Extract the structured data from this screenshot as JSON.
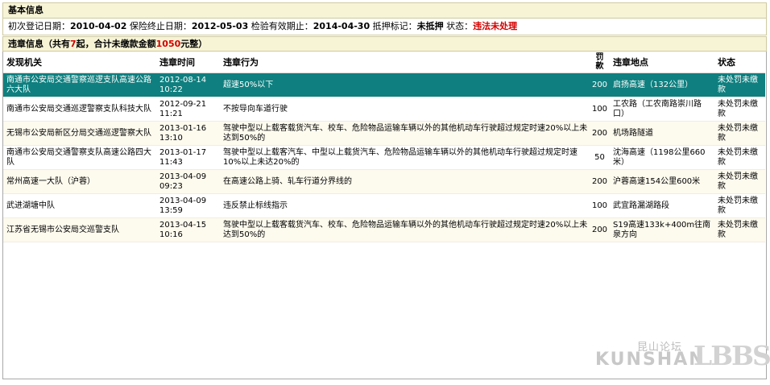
{
  "basic": {
    "title": "基本信息",
    "reg_label": "初次登记日期：",
    "reg_value": "2010-04-02",
    "ins_label": "保险终止日期：",
    "ins_value": "2012-05-03",
    "insp_label": "检验有效期止：",
    "insp_value": "2014-04-30",
    "mort_label": "抵押标记：",
    "mort_value": "未抵押",
    "status_label": "状态：",
    "status_value": "违法未处理"
  },
  "violations": {
    "title_prefix": "违章信息（共有",
    "count": "7",
    "title_mid": "起，合计未缴款金额",
    "amount": "1050",
    "title_suffix": "元整）",
    "columns": {
      "agency": "发现机关",
      "time": "违章时间",
      "behavior": "违章行为",
      "fine_line1": "罚",
      "fine_line2": "款",
      "location": "违章地点",
      "status": "状态"
    },
    "rows": [
      {
        "agency": "南通市公安局交通警察巡逻支队高速公路六大队",
        "time": "2012-08-14 10:22",
        "behavior": "超速50%以下",
        "fine": "200",
        "location": "启扬高速（132公里）",
        "status": "未处罚未缴款"
      },
      {
        "agency": "南通市公安局交通巡逻警察支队科技大队",
        "time": "2012-09-21 11:21",
        "behavior": "不按导向车道行驶",
        "fine": "100",
        "location": "工农路（工农南路崇川路口）",
        "status": "未处罚未缴款"
      },
      {
        "agency": "无锡市公安局新区分局交通巡逻警察大队",
        "time": "2013-01-16 13:10",
        "behavior": "驾驶中型以上载客载货汽车、校车、危险物品运输车辆以外的其他机动车行驶超过规定时速20%以上未达到50%的",
        "fine": "200",
        "location": "机场路隧道",
        "status": "未处罚未缴款"
      },
      {
        "agency": "南通市公安局交通警察支队高速公路四大队",
        "time": "2013-01-17 11:43",
        "behavior": "驾驶中型以上载客汽车、中型以上载货汽车、危险物品运输车辆以外的其他机动车行驶超过规定时速10%以上未达20%的",
        "fine": "50",
        "location": "沈海高速（1198公里660米）",
        "status": "未处罚未缴款"
      },
      {
        "agency": "常州高速一大队（沪蓉）",
        "time": "2013-04-09 09:23",
        "behavior": "在高速公路上骑、轧车行道分界线的",
        "fine": "200",
        "location": "沪蓉高速154公里600米",
        "status": "未处罚未缴款"
      },
      {
        "agency": "武进湖塘中队",
        "time": "2013-04-09 13:59",
        "behavior": "违反禁止标线指示",
        "fine": "100",
        "location": "武宜路漏湖路段",
        "status": "未处罚未缴款"
      },
      {
        "agency": "江苏省无锡市公安局交巡警支队",
        "time": "2013-04-15 10:16",
        "behavior": "驾驶中型以上载客载货汽车、校车、危险物品运输车辆以外的其他机动车行驶超过规定时速20%以上未达到50%的",
        "fine": "200",
        "location": "S19高速133k+400m往南泉方向",
        "status": "未处罚未缴款"
      }
    ]
  },
  "watermark": {
    "cn": "昆山论坛",
    "en": "KUNSHAN",
    "logo": "LBBS"
  },
  "colors": {
    "selected_row": "#0f7f7f",
    "alert_red": "#d40000",
    "header_bg": "#f7f4d6"
  }
}
